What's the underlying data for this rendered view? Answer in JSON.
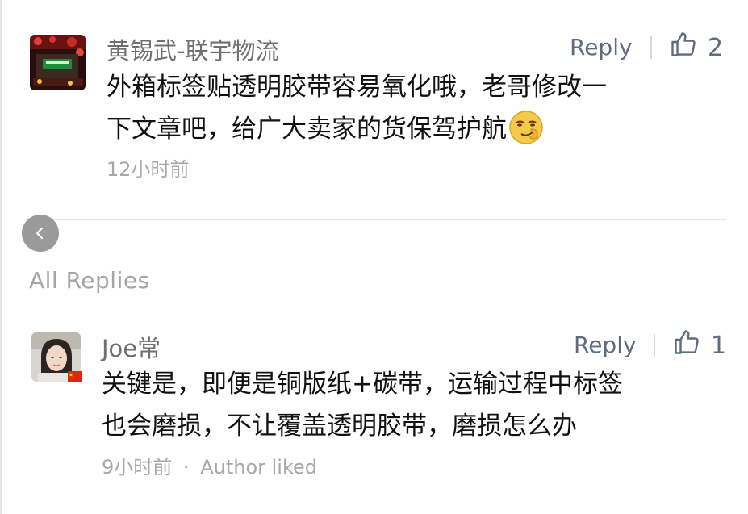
{
  "comments": [
    {
      "author": "黄锡武-联宇物流",
      "reply_label": "Reply",
      "like_count": "2",
      "content_line1": "外箱标签贴透明胶带容易氧化哦，老哥修改一",
      "content_line2": "下文章吧，给广大卖家的货保驾护航",
      "time": "12小时前"
    }
  ],
  "all_replies_label": "All Replies",
  "replies": [
    {
      "author": "Joe常",
      "reply_label": "Reply",
      "like_count": "1",
      "content_line1": "关键是，即便是铜版纸+碳带，运输过程中标签",
      "content_line2": "也会磨损，不让覆盖透明胶带，磨损怎么办",
      "time": "9小时前",
      "meta_sep": "·",
      "author_liked": "Author liked"
    }
  ],
  "colors": {
    "accent": "#5f6c80",
    "name": "#6f6f6f",
    "meta": "#a7a7a7",
    "back_button": "#9a9a9a"
  },
  "icons": {
    "like": "thumbs-up-icon",
    "back": "chevron-left-icon",
    "emoji": "smirk-emoji-icon",
    "flag": "china-flag-icon"
  }
}
